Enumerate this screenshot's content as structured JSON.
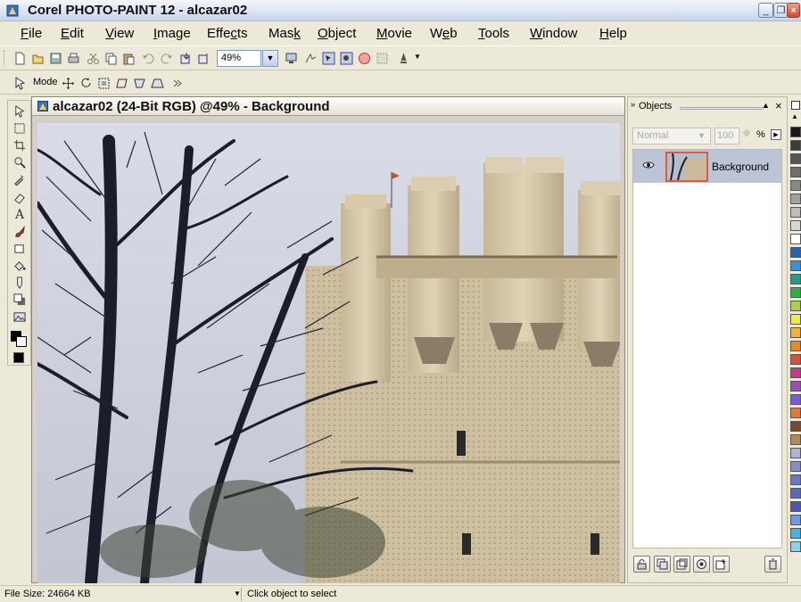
{
  "window": {
    "title": "Corel PHOTO-PAINT 12 - alcazar02"
  },
  "menu": [
    {
      "label": "File",
      "u": "F",
      "rest": "ile"
    },
    {
      "label": "Edit",
      "u": "E",
      "rest": "dit"
    },
    {
      "label": "View",
      "u": "V",
      "rest": "iew"
    },
    {
      "label": "Image",
      "u": "I",
      "rest": "mage"
    },
    {
      "label": "Effects",
      "pre": "Effe",
      "u": "c",
      "rest": "ts"
    },
    {
      "label": "Mask",
      "pre": "Mas",
      "u": "k",
      "rest": ""
    },
    {
      "label": "Object",
      "u": "O",
      "rest": "bject"
    },
    {
      "label": "Movie",
      "u": "M",
      "rest": "ovie"
    },
    {
      "label": "Web",
      "pre": "W",
      "u": "e",
      "rest": "b"
    },
    {
      "label": "Tools",
      "u": "T",
      "rest": "ools"
    },
    {
      "label": "Window",
      "u": "W",
      "rest": "indow"
    },
    {
      "label": "Help",
      "u": "H",
      "rest": "elp"
    }
  ],
  "toolbar": {
    "zoom_value": "49%",
    "mode_label": "Mode"
  },
  "document": {
    "title": "alcazar02 (24-Bit RGB) @49% - Background"
  },
  "objects_docker": {
    "title": "Objects",
    "blend_mode": "Normal",
    "opacity": "100",
    "opacity_unit": "%",
    "layers": [
      {
        "name": "Background",
        "visible": true,
        "selected": true
      }
    ]
  },
  "palette": [
    "#1a1a1a",
    "#3c3c3c",
    "#555555",
    "#6e6e6e",
    "#888888",
    "#a2a2a2",
    "#bcbcbc",
    "#d6d6d6",
    "#ffffff",
    "#2b5fb0",
    "#3c8fd6",
    "#1f9e8a",
    "#2fb04a",
    "#a8d04a",
    "#f3ea45",
    "#f2b235",
    "#e58a2a",
    "#d9503a",
    "#c23a8a",
    "#9a4fb3",
    "#7a5ad6",
    "#e07a3a",
    "#7a4a2a",
    "#b08a5a",
    "#b0b4d6",
    "#8a8ec6",
    "#6a7ac0",
    "#5a6ab8",
    "#4a5aa8",
    "#6a9ae0",
    "#4ab0e0",
    "#8ad0f0"
  ],
  "status": {
    "file_size": "File Size: 24664 KB",
    "message": "Click object to select"
  }
}
